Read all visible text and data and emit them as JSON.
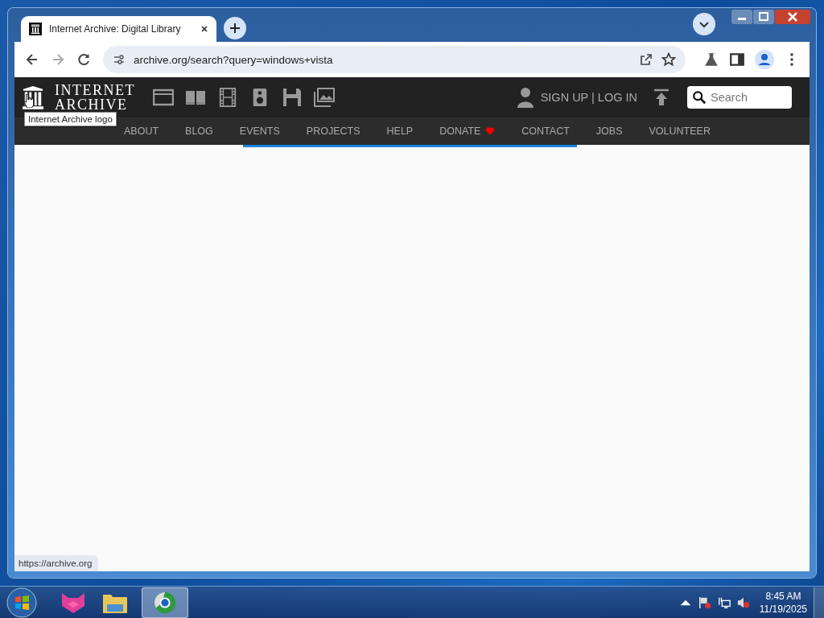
{
  "browser": {
    "tab": {
      "title": "Internet Archive: Digital Library "
    },
    "address": "archive.org/search?query=windows+vista",
    "status_url": "https://archive.org"
  },
  "site": {
    "logo_lines": [
      "INTERNET",
      "ARCHIVE"
    ],
    "tooltip": "Internet Archive logo",
    "account": "SIGN UP | LOG IN",
    "search": {
      "placeholder": "Search"
    },
    "nav": [
      {
        "label": "ABOUT",
        "heart": false
      },
      {
        "label": "BLOG",
        "heart": false
      },
      {
        "label": "EVENTS",
        "heart": false
      },
      {
        "label": "PROJECTS",
        "heart": false
      },
      {
        "label": "HELP",
        "heart": false
      },
      {
        "label": "DONATE",
        "heart": true
      },
      {
        "label": "CONTACT",
        "heart": false
      },
      {
        "label": "JOBS",
        "heart": false
      },
      {
        "label": "VOLUNTEER",
        "heart": false
      }
    ]
  },
  "taskbar": {
    "apps": [
      {
        "kind": "cat",
        "selected": false
      },
      {
        "kind": "folder",
        "selected": false
      },
      {
        "kind": "browser",
        "selected": true
      }
    ],
    "clock": {
      "time": "8:45 AM",
      "date": "11/19/2025"
    }
  }
}
